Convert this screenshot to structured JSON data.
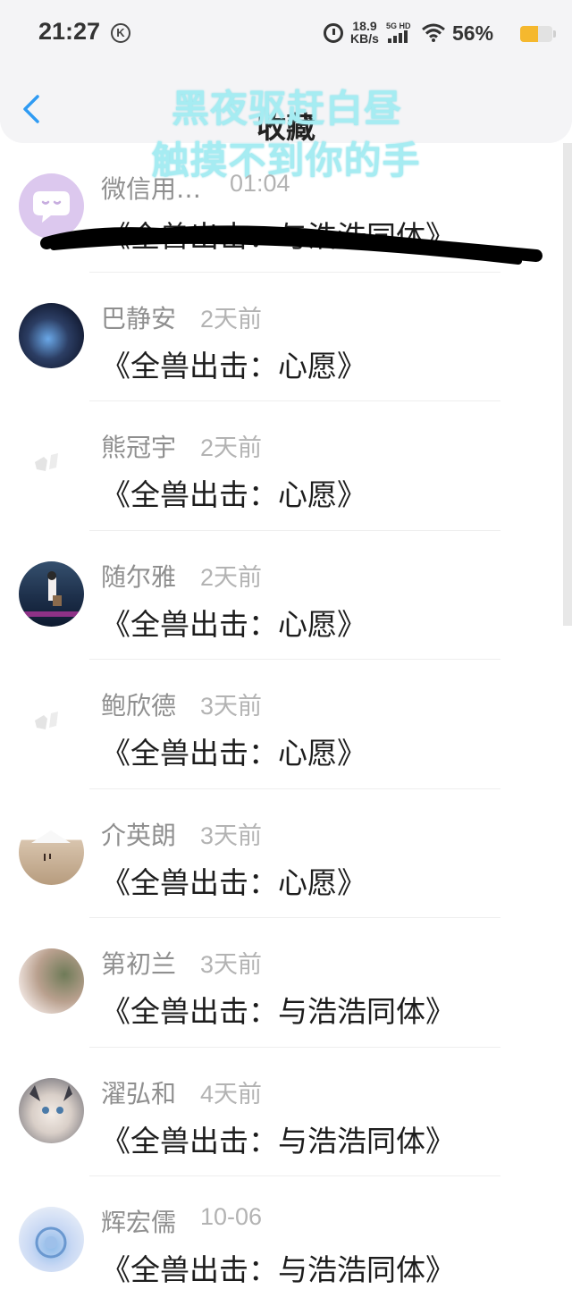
{
  "status_bar": {
    "time": "21:27",
    "k_badge": "K",
    "net_speed_value": "18.9",
    "net_speed_unit": "KB/s",
    "signal_label": "5G HD",
    "battery_percent_text": "56%",
    "battery_level": 0.56,
    "battery_color": "#f5b82e"
  },
  "nav": {
    "title": "收藏",
    "back_icon": "chevron-left-icon",
    "accent_color": "#2f9bf3"
  },
  "overlay_text": {
    "line1": "黑夜驱赶白昼",
    "line2": "触摸不到你的手",
    "color": "#a6ecf2"
  },
  "favorites": [
    {
      "name": "微信用…",
      "time": "01:04",
      "title": "《全兽出击：与浩浩同体》",
      "avatar": "wechat-user-avatar"
    },
    {
      "name": "巴静安",
      "time": "2天前",
      "title": "《全兽出击：心愿》",
      "avatar": "anime-boy-avatar"
    },
    {
      "name": "熊冠宇",
      "time": "2天前",
      "title": "《全兽出击：心愿》",
      "avatar": "default-avatar"
    },
    {
      "name": "随尔雅",
      "time": "2天前",
      "title": "《全兽出击：心愿》",
      "avatar": "ocean-girl-avatar"
    },
    {
      "name": "鲍欣德",
      "time": "3天前",
      "title": "《全兽出击：心愿》",
      "avatar": "default-avatar"
    },
    {
      "name": "介英朗",
      "time": "3天前",
      "title": "《全兽出击：心愿》",
      "avatar": "finger-face-avatar"
    },
    {
      "name": "第初兰",
      "time": "3天前",
      "title": "《全兽出击：与浩浩同体》",
      "avatar": "flower-avatar"
    },
    {
      "name": "濯弘和",
      "time": "4天前",
      "title": "《全兽出击：与浩浩同体》",
      "avatar": "anime-cat-avatar"
    },
    {
      "name": "辉宏儒",
      "time": "10-06",
      "title": "《全兽出击：与浩浩同体》",
      "avatar": "fantasy-avatar"
    }
  ]
}
